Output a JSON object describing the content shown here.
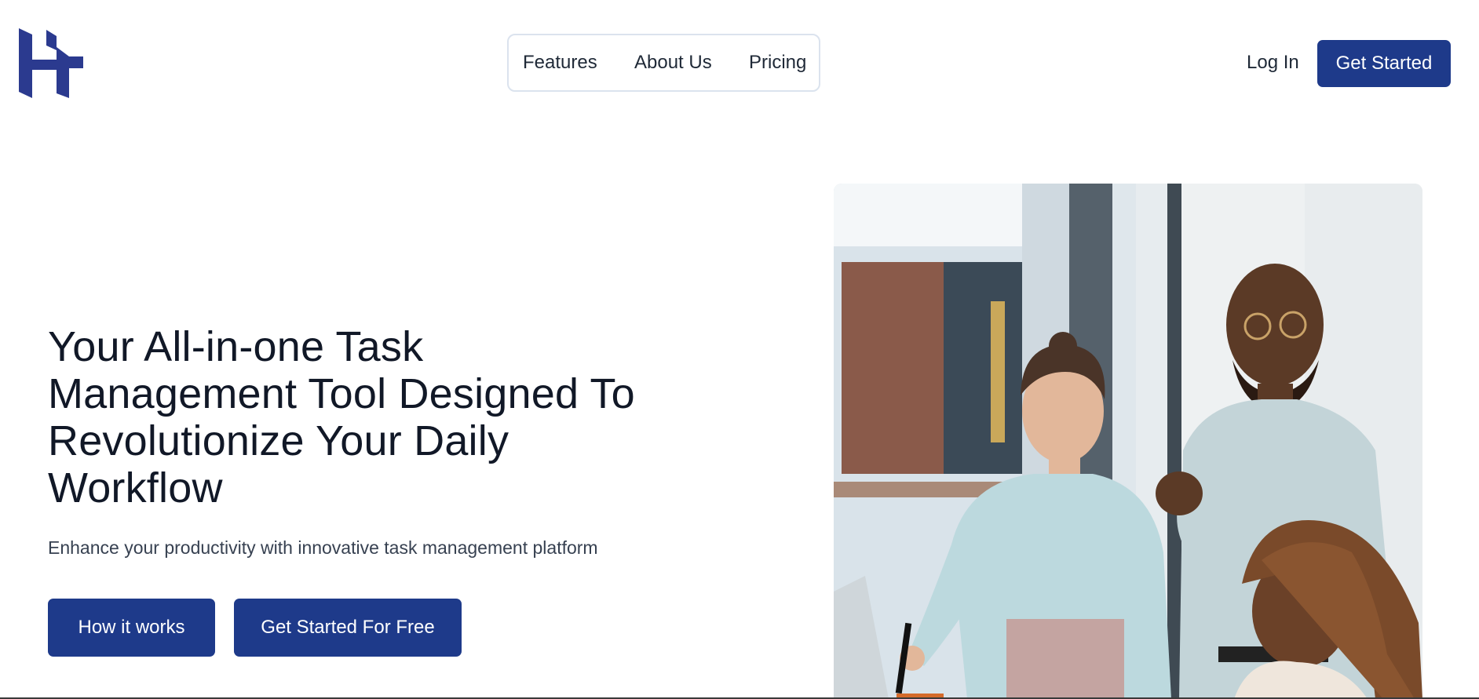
{
  "brand": {
    "logo_icon": "ht-monogram-logo",
    "color": "#2b3a8f"
  },
  "nav": {
    "items": [
      {
        "label": "Features"
      },
      {
        "label": "About Us"
      },
      {
        "label": "Pricing"
      }
    ]
  },
  "header": {
    "login_label": "Log In",
    "cta_label": "Get Started"
  },
  "hero": {
    "title_lines": [
      "Your All-in-one Task",
      "Management Tool Designed To",
      "Revolutionize Your Daily",
      "Workflow"
    ],
    "subtitle": "Enhance your productivity with innovative task management platform",
    "primary_button": "How it works",
    "secondary_button": "Get Started For Free",
    "image_icon": "team-collaboration-photo"
  },
  "colors": {
    "accent": "#1e3a8a",
    "text": "#111827",
    "muted": "#374151",
    "nav_border": "#dbe3ee"
  }
}
